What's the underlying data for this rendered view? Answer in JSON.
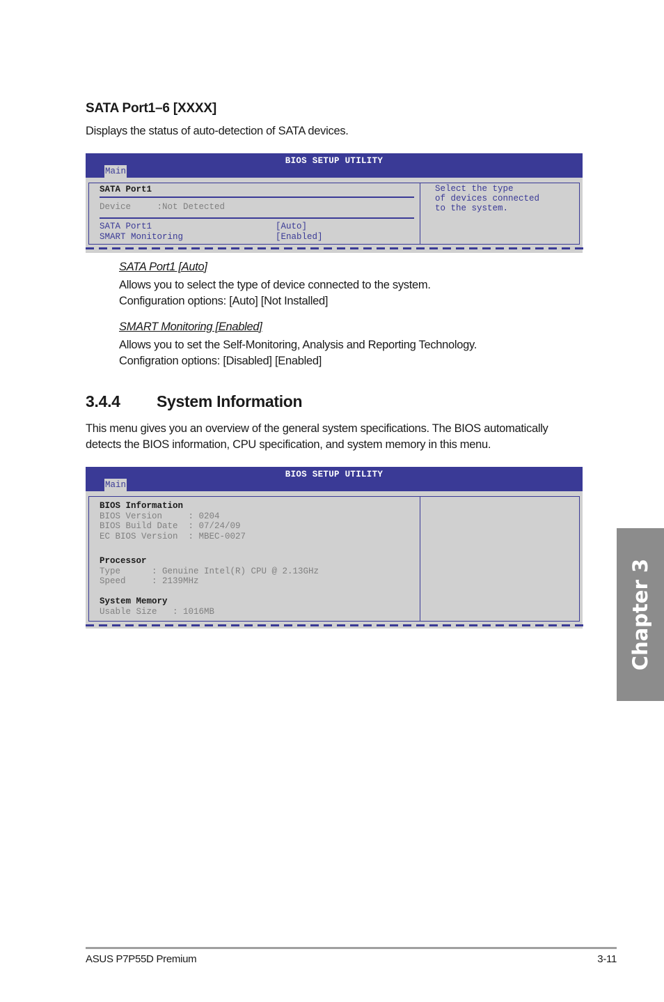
{
  "sata_section": {
    "heading": "SATA Port1–6 [XXXX]",
    "description": "Displays the status of auto-detection of SATA devices."
  },
  "bios1": {
    "title": "BIOS SETUP UTILITY",
    "tab": "Main",
    "panel_title": "SATA Port1",
    "device_row": "Device     :Not Detected",
    "settings": [
      {
        "label": "SATA Port1",
        "value": "[Auto]"
      },
      {
        "label": "SMART Monitoring",
        "value": "[Enabled]"
      }
    ],
    "help_lines": [
      "Select the type",
      "of devices connected",
      "to the system."
    ]
  },
  "options": [
    {
      "title": "SATA Port1 [Auto]",
      "lines": [
        "Allows you to select the type of device connected to the system.",
        "Configuration options: [Auto] [Not Installed]"
      ]
    },
    {
      "title": "SMART Monitoring [Enabled]",
      "lines": [
        "Allows you to set the Self-Monitoring, Analysis and Reporting Technology.",
        "Configration options: [Disabled] [Enabled]"
      ]
    }
  ],
  "system_info": {
    "number": "3.4.4",
    "title": "System Information",
    "lines": [
      "This menu gives you an overview of the general system specifications. The BIOS automatically",
      "detects the BIOS information, CPU specification, and system memory in this menu."
    ]
  },
  "bios2": {
    "title": "BIOS SETUP UTILITY",
    "tab": "Main",
    "groups": [
      {
        "heading": "BIOS Information",
        "rows": [
          "BIOS Version     : 0204",
          "BIOS Build Date  : 07/24/09",
          "EC BIOS Version  : MBEC-0027"
        ]
      },
      {
        "heading": "Processor",
        "rows": [
          "Type      : Genuine Intel(R) CPU @ 2.13GHz",
          "Speed     : 2139MHz"
        ]
      },
      {
        "heading": "System Memory",
        "rows": [
          "Usable Size   : 1016MB"
        ]
      }
    ]
  },
  "chapter_tab": "Chapter 3",
  "footer": {
    "product": "ASUS P7P55D Premium",
    "page": "3-11"
  }
}
